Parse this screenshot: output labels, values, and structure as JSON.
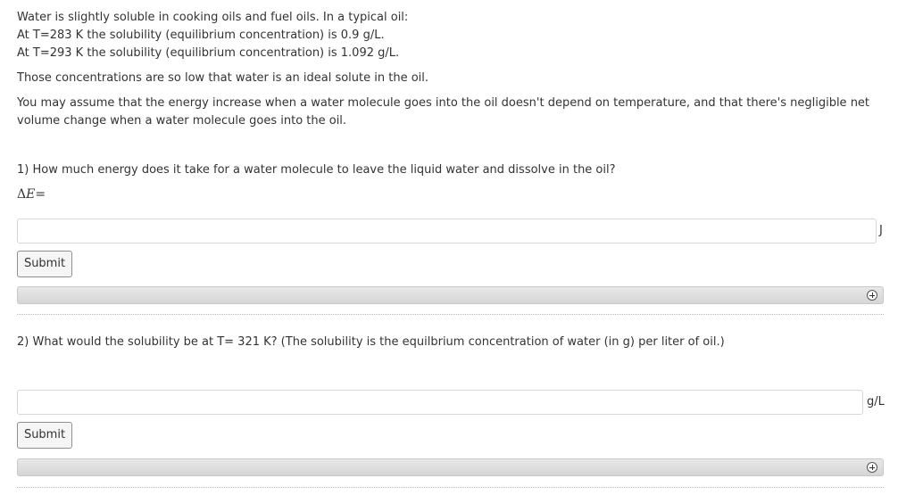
{
  "intro": {
    "line1": "Water is slightly soluble in cooking oils and fuel oils. In a typical oil:",
    "line2": "At T=283 K the solubility (equilibrium concentration) is 0.9 g/L.",
    "line3": "At T=293 K the solubility (equilibrium concentration) is 1.092 g/L.",
    "line4": "Those concentrations are so low that water is an ideal solute in the oil.",
    "line5": "You may assume that the energy increase when a water molecule goes into the oil doesn't depend on temperature, and that there's negligible net volume change when a water molecule goes into the oil."
  },
  "question1": {
    "text": "1) How much energy does it take for a water molecule to leave the liquid water and dissolve in the oil?",
    "label_delta": "Δ",
    "label_var": "E",
    "label_eq": "=",
    "answer_value": "",
    "unit": "J",
    "submit_label": "Submit"
  },
  "question2": {
    "text": "2) What would the solubility be at T= 321 K? (The solubility is the equilbrium concentration of water (in g) per liter of oil.)",
    "answer_value": "",
    "unit": "g/L",
    "submit_label": "Submit"
  },
  "icons": {
    "expand": "plus-circle-icon"
  }
}
